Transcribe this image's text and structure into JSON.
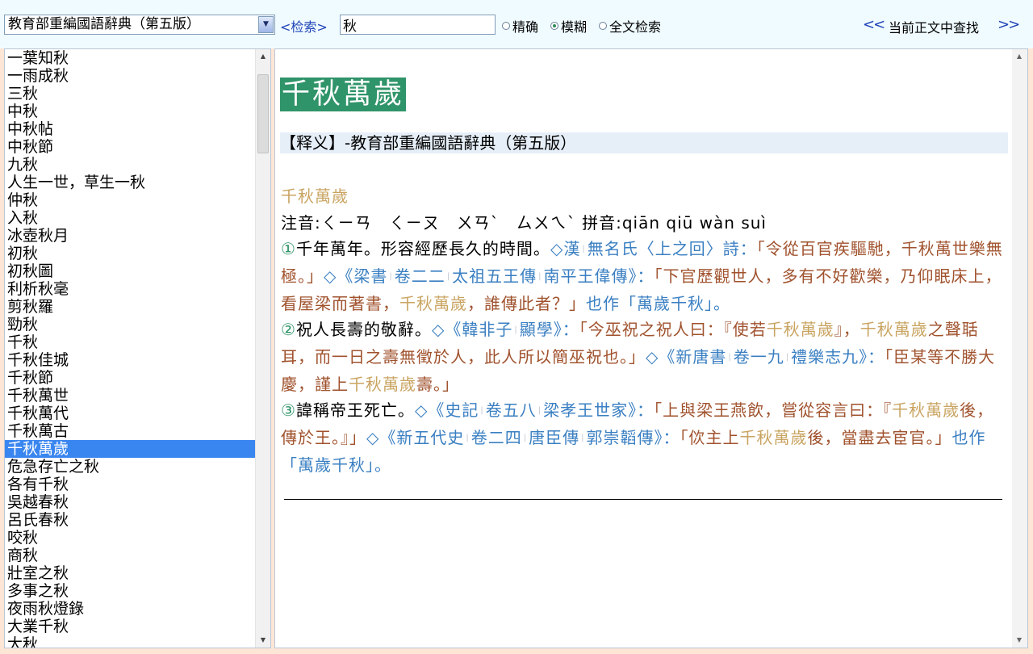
{
  "toolbar": {
    "dictionary_selected": "教育部重編國語辭典（第五版）",
    "search_label": "<检索>",
    "search_value": "秋",
    "radio_exact": "精确",
    "radio_fuzzy": "模糊",
    "radio_fulltext": "全文检索",
    "selected_mode": "模糊",
    "nav_prev": "<<",
    "nav_label": "当前正文中查找",
    "nav_next": ">>"
  },
  "word_list": {
    "items": [
      "一葉知秋",
      "一雨成秋",
      "三秋",
      "中秋",
      "中秋帖",
      "中秋節",
      "九秋",
      "人生一世，草生一秋",
      "仲秋",
      "入秋",
      "冰壺秋月",
      "初秋",
      "初秋圖",
      "利析秋毫",
      "剪秋羅",
      "勁秋",
      "千秋",
      "千秋佳城",
      "千秋節",
      "千秋萬世",
      "千秋萬代",
      "千秋萬古",
      "千秋萬歲",
      "危急存亡之秋",
      "各有千秋",
      "吳越春秋",
      "呂氏春秋",
      "咬秋",
      "商秋",
      "壯室之秋",
      "多事之秋",
      "夜雨秋燈錄",
      "大業千秋",
      "大秋"
    ],
    "selected": "千秋萬歲"
  },
  "entry": {
    "title": "千秋萬歲",
    "source": "【释义】-教育部重編國語辭典（第五版）",
    "headword": "千秋萬歲",
    "phonetic_label": "注音:",
    "bopomofo": "ㄑㄧㄢ　ㄑㄧㄡ　ㄨㄢˋ　ㄙㄨㄟˋ",
    "pinyin_label": " 拼音:",
    "pinyin": "qiān qiū wàn suì",
    "sense1": {
      "num": "①",
      "def": "千年萬年。形容經歷長久的時間。",
      "q1_src_a": "◇漢",
      "q1_src_b": "無名氏〈上之回〉詩：",
      "q1_text": "「令從百官疾驅馳，千秋萬世樂無極。」",
      "q2_src_a": "◇《梁書",
      "q2_src_b": "卷二二",
      "q2_src_c": "太祖五王傳",
      "q2_src_d": "南平王偉傳》：",
      "q2_text_a": "「下官歷觀世人，多有不好歡樂，乃仰眠床上，看屋梁而著書，",
      "q2_term": "千秋萬歲",
      "q2_text_b": "，誰傳此者？」",
      "also": "也作",
      "alt": "「萬歲千秋」",
      "end": "。"
    },
    "sense2": {
      "num": "②",
      "def": "祝人長壽的敬辭。",
      "q1_src_a": "◇《韓非子",
      "q1_src_b": "顯學》：",
      "q1_text_a": "「今巫祝之祝人曰：『使若",
      "q1_term_a": "千秋萬歲",
      "q1_text_b": "』，",
      "q1_term_b": "千秋萬歲",
      "q1_text_c": "之聲聒耳，而一日之壽無徵於人，此人所以簡巫祝也。」",
      "q2_src_a": "◇《新唐書",
      "q2_src_b": "卷一九",
      "q2_src_c": "禮樂志九》：",
      "q2_text_a": "「臣某等不勝大慶，謹上",
      "q2_term": "千秋萬歲",
      "q2_text_b": "壽。」"
    },
    "sense3": {
      "num": "③",
      "def": "諱稱帝王死亡。",
      "q1_src_a": "◇《史記",
      "q1_src_b": "卷五八",
      "q1_src_c": "梁孝王世家》：",
      "q1_text_a": "「上與梁王燕飲，嘗從容言曰：『",
      "q1_term": "千秋萬歲",
      "q1_text_b": "後，傳於王。』」",
      "q2_src_a": "◇《新五代史",
      "q2_src_b": "卷二四",
      "q2_src_c": "唐臣傳",
      "q2_src_d": "郭崇韜傳》：",
      "q2_text_a": "「佽主上",
      "q2_term": "千秋萬歲",
      "q2_text_b": "後，當盡去宦官。」",
      "also": "也作",
      "alt": "「萬歲千秋」",
      "end": "。"
    }
  },
  "colors": {
    "title_bg": "#2f9469",
    "selection": "#3a86f0",
    "quote": "#a0522d",
    "source": "#3a7fc2",
    "term": "#c9a461"
  }
}
